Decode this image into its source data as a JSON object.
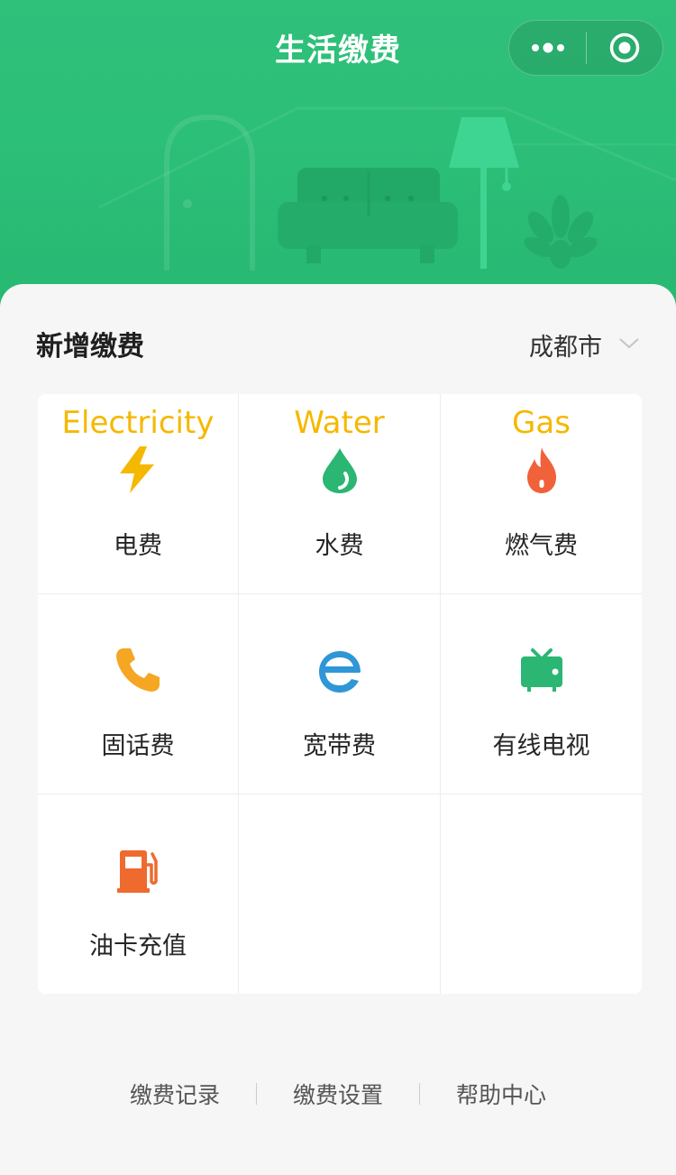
{
  "header": {
    "title": "生活缴费"
  },
  "section": {
    "title": "新增缴费",
    "city": "成都市"
  },
  "services": [
    {
      "en": "Electricity",
      "label": "电费",
      "icon": "lightning-icon",
      "color": "#f5b800"
    },
    {
      "en": "Water",
      "label": "水费",
      "icon": "water-drop-icon",
      "color": "#2bb673"
    },
    {
      "en": "Gas",
      "label": "燃气费",
      "icon": "flame-icon",
      "color": "#f1613a"
    },
    {
      "en": "",
      "label": "固话费",
      "icon": "phone-icon",
      "color": "#f5a623"
    },
    {
      "en": "",
      "label": "宽带费",
      "icon": "broadband-e-icon",
      "color": "#2f96d8"
    },
    {
      "en": "",
      "label": "有线电视",
      "icon": "tv-icon",
      "color": "#2bb673"
    },
    {
      "en": "",
      "label": "油卡充值",
      "icon": "fuel-pump-icon",
      "color": "#ee6a2f"
    }
  ],
  "footer": {
    "links": [
      "缴费记录",
      "缴费设置",
      "帮助中心"
    ]
  },
  "colors": {
    "brand_green": "#2cbf78",
    "accent_yellow": "#f5b800"
  }
}
